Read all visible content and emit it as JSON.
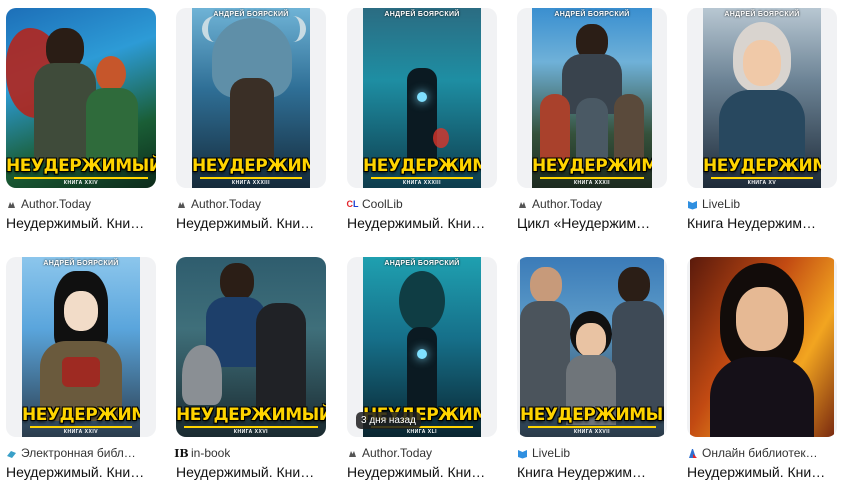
{
  "colors": {
    "title_yellow": "#ffd400",
    "coollib_red": "#e3242b",
    "coollib_blue": "#1a3fd1",
    "livelib_blue": "#2f8fe0"
  },
  "cover_author": "АНДРЕЙ БОЯРСКИЙ",
  "cover_title": "НЕУДЕРЖИМЫЙ",
  "cards": [
    {
      "source": "Author.Today",
      "source_icon": "author-today-icon",
      "title": "Неудержимый. Кни…",
      "book": "КНИГА XXIV"
    },
    {
      "source": "Author.Today",
      "source_icon": "author-today-icon",
      "title": "Неудержимый. Кни…",
      "book": "КНИГА XXXIII"
    },
    {
      "source": "CoolLib",
      "source_icon": "coollib-icon",
      "title": "Неудержимый. Кни…",
      "book": "КНИГА XXXIII"
    },
    {
      "source": "Author.Today",
      "source_icon": "author-today-icon",
      "title": "Цикл «Неудержим…",
      "book": "КНИГА XXXII"
    },
    {
      "source": "LiveLib",
      "source_icon": "livelib-icon",
      "title": "Книга Неудержим…",
      "book": "КНИГА XV"
    },
    {
      "source": "Электронная библ…",
      "source_icon": "library-icon",
      "title": "Неудержимый. Кни…",
      "book": "КНИГА XXIV"
    },
    {
      "source": "in-book",
      "source_icon": "in-book-icon",
      "title": "Неудержимый. Кни…",
      "book": "КНИГА XXVI"
    },
    {
      "source": "Author.Today",
      "source_icon": "author-today-icon",
      "title": "Неудержимый. Кни…",
      "book": "КНИГА XLI",
      "badge": "3 дня назад"
    },
    {
      "source": "LiveLib",
      "source_icon": "livelib-icon",
      "title": "Книга Неудержим…",
      "book": "КНИГА XXVII"
    },
    {
      "source": "Онлайн библиотек…",
      "source_icon": "online-library-icon",
      "title": "Неудержимый. Кни…",
      "book": ""
    }
  ]
}
